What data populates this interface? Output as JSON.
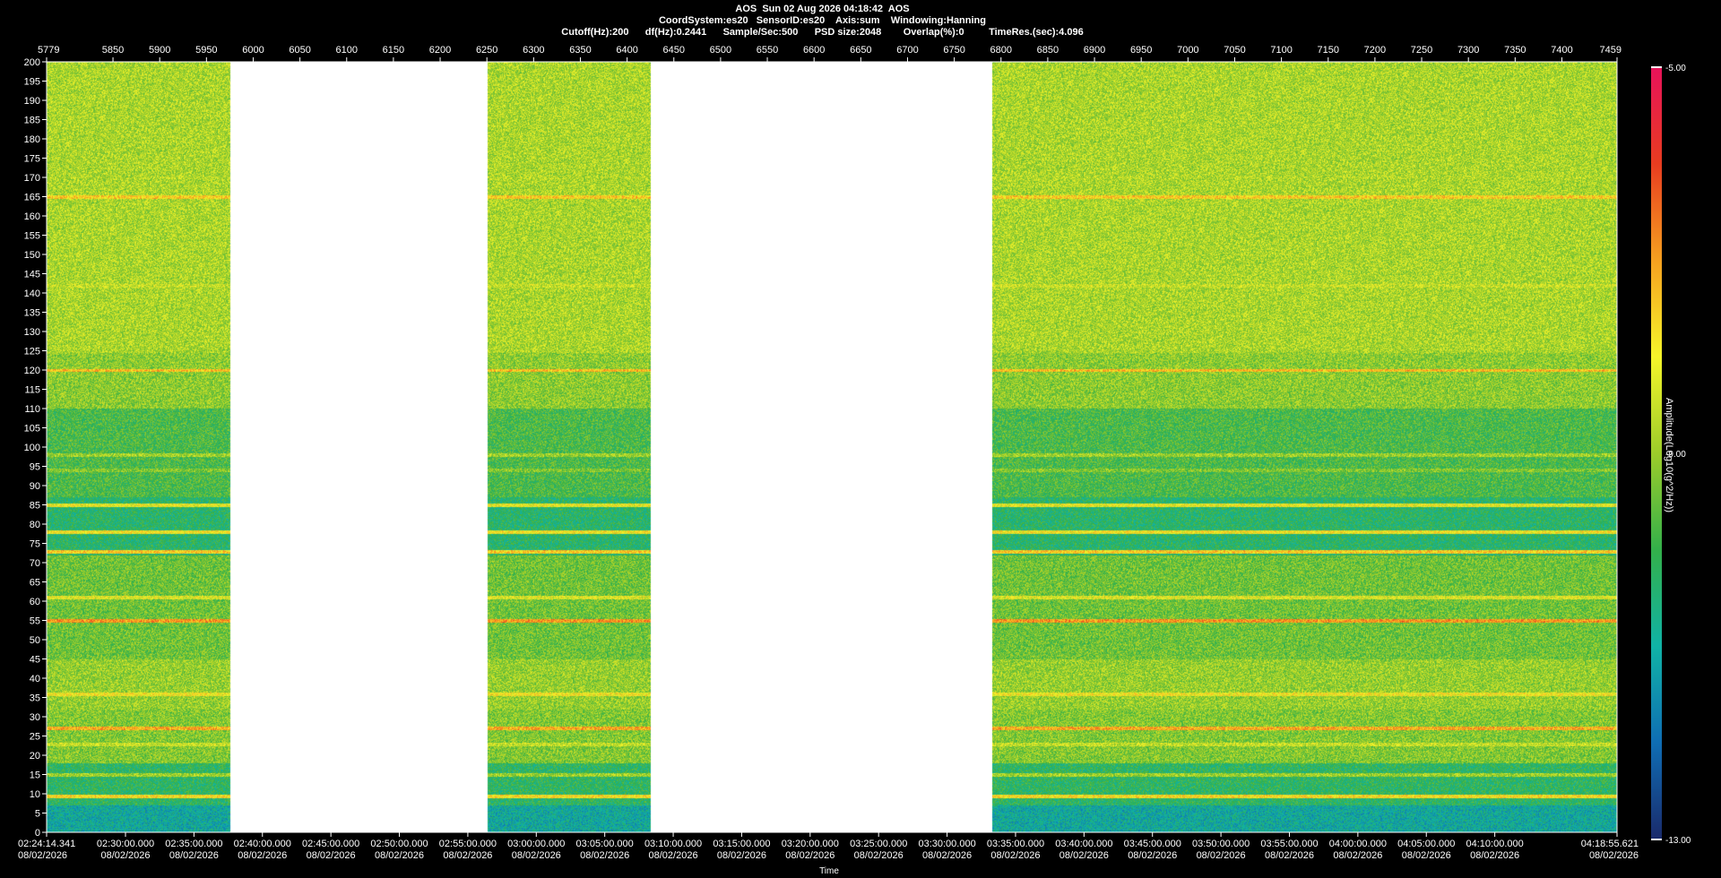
{
  "header": {
    "line1": "AOS  Sun 02 Aug 2026 04:18:42  AOS",
    "line2": "CoordSystem:es20   SensorID:es20    Axis:sum    Windowing:Hanning",
    "line3": "Cutoff(Hz):200      df(Hz):0.2441      Sample/Sec:500      PSD size:2048        Overlap(%):0         TimeRes.(sec):4.096"
  },
  "chart_data": {
    "type": "heatmap",
    "title": "AOS  Sun 02 Aug 2026 04:18:42  AOS",
    "xlabel": "Time",
    "ylabel": "",
    "y_range": [
      0,
      200
    ],
    "y_ticks": [
      0,
      5,
      10,
      15,
      20,
      25,
      30,
      35,
      40,
      45,
      50,
      55,
      60,
      65,
      70,
      75,
      80,
      85,
      90,
      95,
      100,
      105,
      110,
      115,
      120,
      125,
      130,
      135,
      140,
      145,
      150,
      155,
      160,
      165,
      170,
      175,
      180,
      185,
      190,
      195,
      200
    ],
    "top_axis_range": [
      5779,
      7459
    ],
    "top_axis_ticks": [
      "5779",
      "5850",
      "5900",
      "5950",
      "6000",
      "6050",
      "6100",
      "6150",
      "6200",
      "6250",
      "6300",
      "6350",
      "6400",
      "6450",
      "6500",
      "6550",
      "6600",
      "6650",
      "6700",
      "6750",
      "6800",
      "6850",
      "6900",
      "6950",
      "7000",
      "7050",
      "7100",
      "7150",
      "7200",
      "7250",
      "7300",
      "7350",
      "7400",
      "7459"
    ],
    "bottom_axis_ticks": [
      {
        "time": "02:24:14.341",
        "date": "08/02/2026"
      },
      {
        "time": "02:30:00.000",
        "date": "08/02/2026"
      },
      {
        "time": "02:35:00.000",
        "date": "08/02/2026"
      },
      {
        "time": "02:40:00.000",
        "date": "08/02/2026"
      },
      {
        "time": "02:45:00.000",
        "date": "08/02/2026"
      },
      {
        "time": "02:50:00.000",
        "date": "08/02/2026"
      },
      {
        "time": "02:55:00.000",
        "date": "08/02/2026"
      },
      {
        "time": "03:00:00.000",
        "date": "08/02/2026"
      },
      {
        "time": "03:05:00.000",
        "date": "08/02/2026"
      },
      {
        "time": "03:10:00.000",
        "date": "08/02/2026"
      },
      {
        "time": "03:15:00.000",
        "date": "08/02/2026"
      },
      {
        "time": "03:20:00.000",
        "date": "08/02/2026"
      },
      {
        "time": "03:25:00.000",
        "date": "08/02/2026"
      },
      {
        "time": "03:30:00.000",
        "date": "08/02/2026"
      },
      {
        "time": "03:35:00.000",
        "date": "08/02/2026"
      },
      {
        "time": "03:40:00.000",
        "date": "08/02/2026"
      },
      {
        "time": "03:45:00.000",
        "date": "08/02/2026"
      },
      {
        "time": "03:50:00.000",
        "date": "08/02/2026"
      },
      {
        "time": "03:55:00.000",
        "date": "08/02/2026"
      },
      {
        "time": "04:00:00.000",
        "date": "08/02/2026"
      },
      {
        "time": "04:05:00.000",
        "date": "08/02/2026"
      },
      {
        "time": "04:10:00.000",
        "date": "08/02/2026"
      },
      {
        "time": "04:18:55.621",
        "date": "08/02/2026"
      }
    ],
    "data_gaps_top_axis": [
      [
        5975,
        6250
      ],
      [
        6425,
        6790
      ]
    ],
    "tonal_lines_hz": [
      {
        "freq": 200,
        "level": -9.2
      },
      {
        "freq": 188,
        "level": -9.0
      },
      {
        "freq": 170,
        "level": -8.8
      },
      {
        "freq": 165,
        "level": -7.6
      },
      {
        "freq": 142,
        "level": -8.6
      },
      {
        "freq": 125,
        "level": -8.9
      },
      {
        "freq": 120,
        "level": -7.4
      },
      {
        "freq": 98,
        "level": -9.0
      },
      {
        "freq": 94,
        "level": -9.3
      },
      {
        "freq": 85,
        "level": -8.2
      },
      {
        "freq": 78,
        "level": -8.0
      },
      {
        "freq": 73,
        "level": -7.6
      },
      {
        "freq": 61,
        "level": -8.3
      },
      {
        "freq": 55,
        "level": -7.0
      },
      {
        "freq": 36,
        "level": -8.0
      },
      {
        "freq": 27,
        "level": -7.2
      },
      {
        "freq": 23,
        "level": -8.6
      },
      {
        "freq": 15,
        "level": -9.0
      },
      {
        "freq": 9.5,
        "level": -7.8
      }
    ],
    "colorbar": {
      "label": "Amplitude(Log10(g^2/Hz))",
      "min": -13.0,
      "max": -5.0,
      "tick_labels": [
        "-5.00",
        "-9.00",
        "-13.00"
      ],
      "colors": [
        "#1a2a6b",
        "#0f6db4",
        "#10b3a6",
        "#33b04a",
        "#9ccc2a",
        "#f5f52a",
        "#f5a020",
        "#e83c20",
        "#e8125a"
      ]
    }
  }
}
